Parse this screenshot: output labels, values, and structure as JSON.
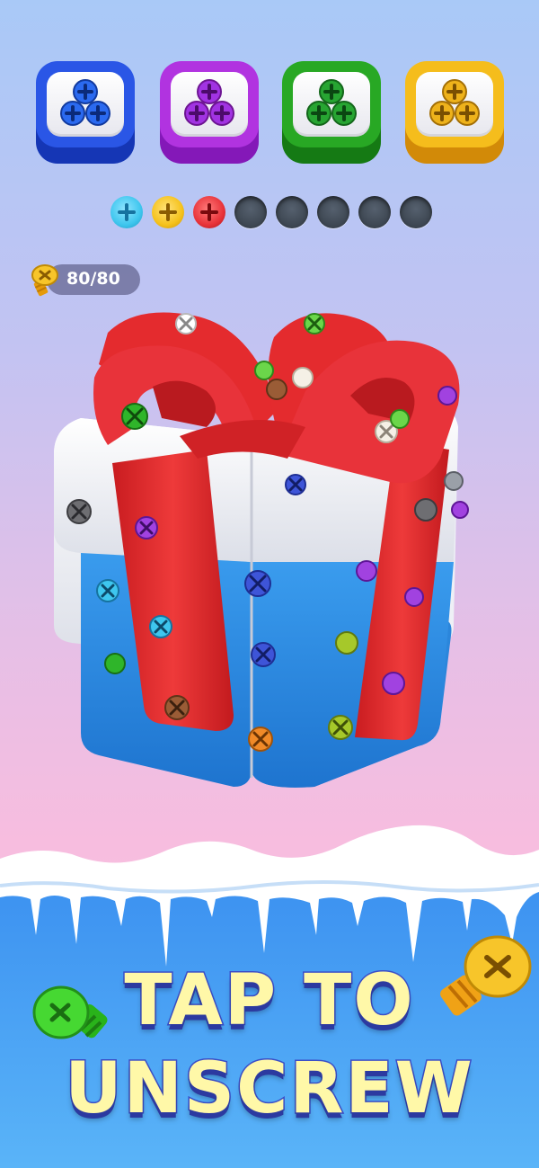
{
  "screw_boxes": [
    {
      "color": "blue",
      "hex": "#2a56e6",
      "dark": "#1536b5",
      "screw": "#2b6af0"
    },
    {
      "color": "purple",
      "hex": "#b133e0",
      "dark": "#8418b8",
      "screw": "#a133e2"
    },
    {
      "color": "green",
      "hex": "#28a824",
      "dark": "#157a14",
      "screw": "#27a532"
    },
    {
      "color": "yellow",
      "hex": "#f5bd1c",
      "dark": "#d28a08",
      "screw": "#eeb21b"
    }
  ],
  "holding_slots": [
    {
      "state": "filled",
      "color": "#3ec6ee"
    },
    {
      "state": "filled",
      "color": "#f5c21c"
    },
    {
      "state": "filled",
      "color": "#e8333a"
    },
    {
      "state": "empty"
    },
    {
      "state": "empty"
    },
    {
      "state": "empty"
    },
    {
      "state": "empty"
    },
    {
      "state": "empty"
    }
  ],
  "screw_counter": {
    "value": "80/80",
    "icon": "gold-screw-icon"
  },
  "gift": {
    "ribbon": "#e42b2e",
    "top": "#ffffff",
    "bottom": "#2b8de0"
  },
  "cta": {
    "line1": "TAP TO",
    "line2": "UNSCREW"
  },
  "decorations": [
    {
      "icon": "green-screw-icon",
      "color": "#3ad12a"
    },
    {
      "icon": "orange-screw-icon",
      "color": "#f4b21c"
    }
  ]
}
